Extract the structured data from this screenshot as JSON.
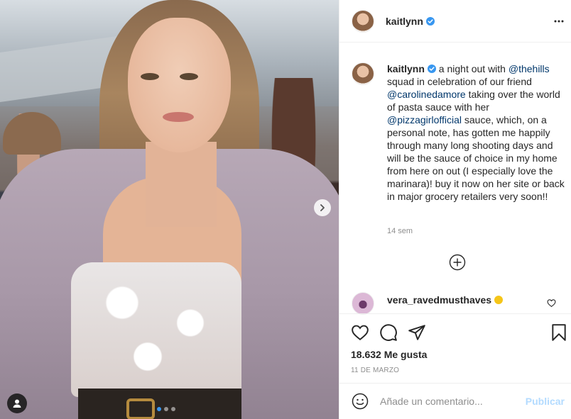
{
  "post": {
    "carousel": {
      "slide_count": 3,
      "active_index": 0
    },
    "author": {
      "username": "kaitlynn",
      "verified": true
    },
    "caption": {
      "username": "kaitlynn",
      "text_1": " a night out with ",
      "mention_1": "@thehills",
      "text_2": " squad in celebration of our friend ",
      "mention_2": "@carolinedamore",
      "text_3": " taking over the world of pasta sauce with her ",
      "mention_3": "@pizzagirlofficial",
      "text_4": " sauce, which, on a personal note, has gotten me happily through many long shooting days and will be the sauce of choice in my home from here on out (I especially love the marinara)! buy it now on her site or back in major grocery retailers very soon!!"
    },
    "time_ago": "14 sem",
    "comments": [
      {
        "username": "vera_ravedmusthaves",
        "emoji": "smiling-face"
      }
    ],
    "likes": "18.632 Me gusta",
    "date": "11 DE MARZO",
    "add_comment": {
      "placeholder": "Añade un comentario...",
      "publish_label": "Publicar"
    }
  },
  "colors": {
    "accent": "#3897f0",
    "mention": "#00376b",
    "muted": "#8e8e8e",
    "publish_disabled": "#b3dbff"
  },
  "icons": [
    "chevron-right-icon",
    "user-tag-icon",
    "verified-badge-icon",
    "more-options-icon",
    "load-more-plus-icon",
    "heart-icon",
    "comment-icon",
    "share-icon",
    "bookmark-icon",
    "emoji-icon"
  ]
}
